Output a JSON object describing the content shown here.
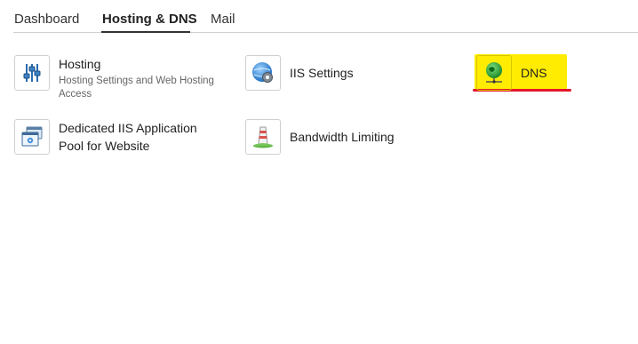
{
  "tabs": [
    {
      "label": "Dashboard",
      "active": false
    },
    {
      "label": "Hosting & DNS",
      "active": true
    },
    {
      "label": "Mail",
      "active": false
    }
  ],
  "tools": {
    "hosting": {
      "title": "Hosting",
      "description": "Hosting Settings and Web Hosting Access",
      "icon": "sliders-icon"
    },
    "iis_settings": {
      "title": "IIS Settings",
      "icon": "iis-globe-gear-icon"
    },
    "dns": {
      "title": "DNS",
      "icon": "dns-globe-icon"
    },
    "dedicated_pool": {
      "title_line1": "Dedicated IIS Application",
      "title_line2": "Pool for Website",
      "icon": "app-pool-windows-icon"
    },
    "bandwidth": {
      "title": "Bandwidth Limiting",
      "icon": "bandwidth-tower-icon"
    }
  },
  "annotation": {
    "highlight_color": "#ffec00",
    "underline_color": "#e3172b"
  }
}
